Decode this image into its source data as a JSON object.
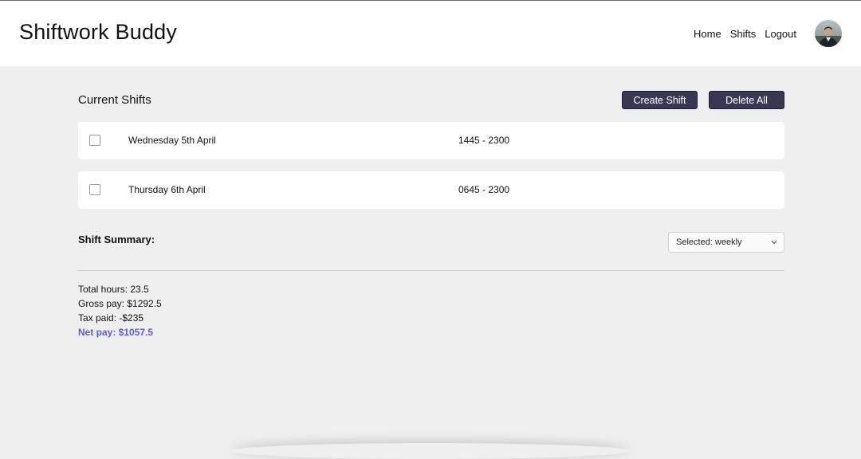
{
  "header": {
    "brand": "Shiftwork Buddy",
    "nav": [
      {
        "label": "Home"
      },
      {
        "label": "Shifts"
      },
      {
        "label": "Logout"
      }
    ]
  },
  "shifts": {
    "title": "Current Shifts",
    "create_label": "Create Shift",
    "delete_label": "Delete All",
    "items": [
      {
        "date": "Wednesday 5th April",
        "time": "1445 - 2300"
      },
      {
        "date": "Thursday 6th April",
        "time": "0645 - 2300"
      }
    ]
  },
  "summary": {
    "title": "Shift Summary:",
    "select_value": "Selected: weekly",
    "total_hours": "Total hours: 23.5",
    "gross_pay": "Gross pay: $1292.5",
    "tax_paid": "Tax paid: -$235",
    "net_pay": "Net pay: $1057.5"
  },
  "colors": {
    "button_bg": "#3a3753",
    "net_pay": "#5a5ad6",
    "page_bg": "#efefef"
  },
  "icons": {
    "avatar": "profile-photo",
    "select_arrow": "chevron-down-icon"
  }
}
